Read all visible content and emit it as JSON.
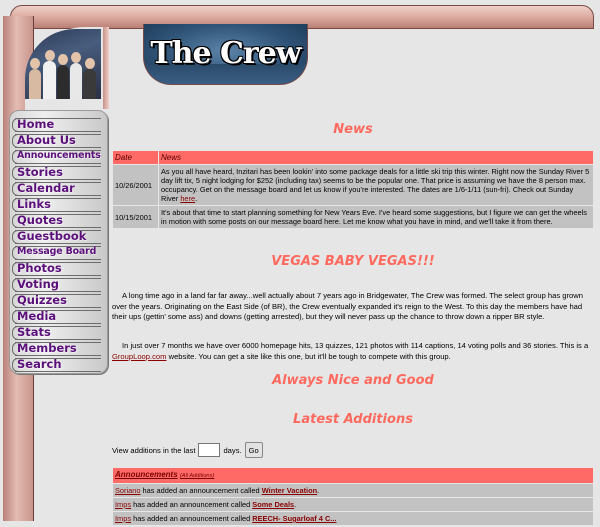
{
  "site": {
    "logo_text": "The Crew",
    "colors": {
      "accent": "#ff6a5f",
      "nav_text": "#5b0f7a",
      "frame": "#d9a79c",
      "table_header": "#ff6a66",
      "row_bg": "#c2c2c2"
    }
  },
  "nav": {
    "items": [
      {
        "label": "Home"
      },
      {
        "label": "About Us"
      },
      {
        "label": "Announcements"
      },
      {
        "label": "Stories"
      },
      {
        "label": "Calendar"
      },
      {
        "label": "Links"
      },
      {
        "label": "Quotes"
      },
      {
        "label": "Guestbook"
      },
      {
        "label": "Message Board"
      },
      {
        "label": "Photos"
      },
      {
        "label": "Voting"
      },
      {
        "label": "Quizzes"
      },
      {
        "label": "Media"
      },
      {
        "label": "Stats"
      },
      {
        "label": "Members"
      },
      {
        "label": "Search"
      }
    ]
  },
  "news": {
    "title": "News",
    "col_date": "Date",
    "col_news": "News",
    "rows": [
      {
        "date": "10/26/2001",
        "text": "As you all have heard, Inzitari has been lookin' into some package deals for a little ski trip this winter.  Right now the Sunday River 5 day lift tix, 5 night lodging for $252 (including tax) seems to be the popular one.  That price is assuming we have the 8 person max. occupancy.  Get on the message board and let us know if you're interested.  The dates are 1/6-1/11 (sun-fri).  Check out Sunday River",
        "link": "here",
        "tail": "."
      },
      {
        "date": "10/15/2001",
        "text": "It's about that time to start planning something for New Years Eve.  I've heard some suggestions, but I figure we can get the wheels in motion with some posts on our message board here.  Let me know what you have in mind, and we'll take it from there."
      }
    ]
  },
  "vegas": {
    "title": "VEGAS BABY VEGAS!!!",
    "para1": "A long time ago in a land far far away...well actually about 7 years ago in Bridgewater, The Crew was formed.  The select group has grown over the years.  Originating on the East Side (of BR), the Crew eventually expanded it's reign to the West.  To this day the members have had their ups (gettin' some ass) and downs (getting arrested), but they will never pass up the chance to throw down a ripper BR style.",
    "para2_a": "In just over 7 months we have over 6000 homepage hits, 13 quizzes, 121 photos with 114 captions, 14 voting polls and 36 stories.  This is a",
    "para2_link": "GroupLoop.com",
    "para2_b": "website.  You can get a site like this one, but it'll be tough to compete with this group."
  },
  "always": {
    "title": "Always Nice and Good"
  },
  "latest": {
    "title": "Latest Additions",
    "view_prefix": "View additions in the last",
    "view_suffix": "days.",
    "days_value": "",
    "go_label": "Go",
    "ann_header": "Announcements",
    "ann_sub": "(All Additions)",
    "rows": [
      {
        "user": "Soriano",
        "mid": "has added an announcement called",
        "item": "Winter Vacation",
        "end": "."
      },
      {
        "user": "Imps",
        "mid": "has added an announcement called",
        "item": "Some Deals",
        "end": "."
      },
      {
        "user": "Imps",
        "mid": "has added an announcement called",
        "item": "REECH- Sugarloaf 4 C...",
        "end": ""
      }
    ]
  }
}
